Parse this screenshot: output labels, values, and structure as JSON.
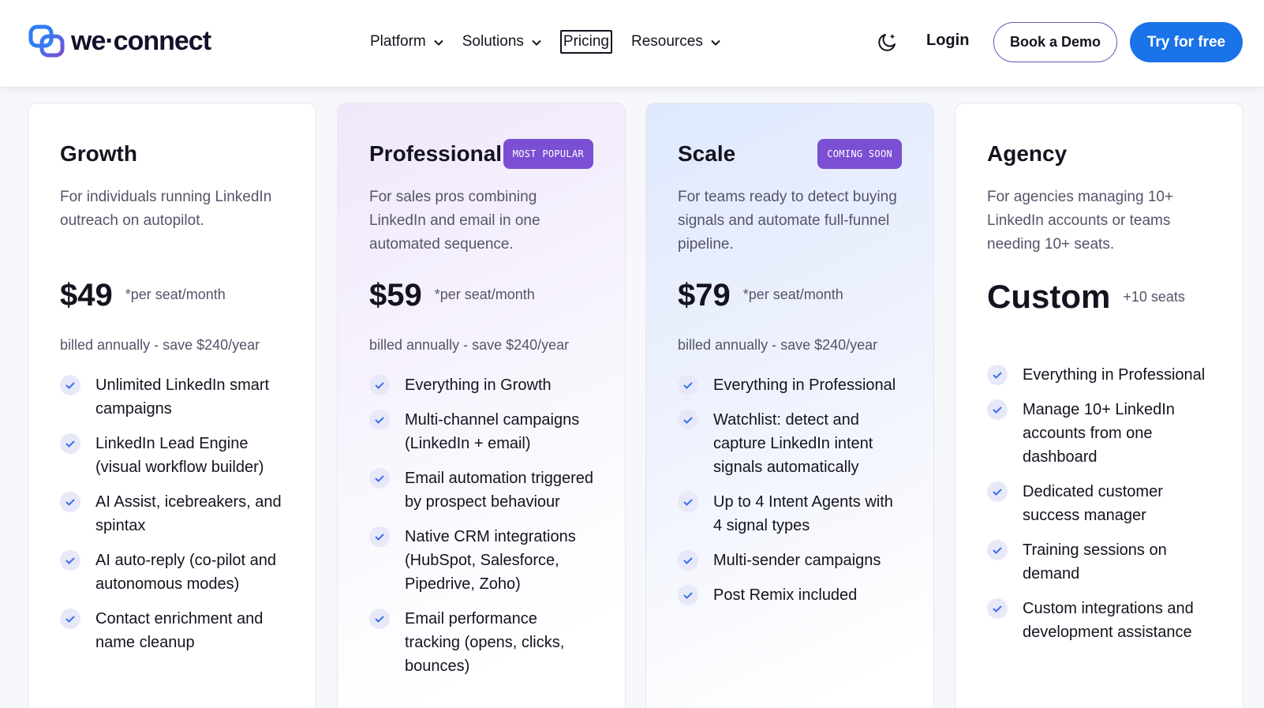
{
  "brand": {
    "name": "we·connect",
    "accent": "#1a73e8",
    "purple": "#7a4fd3"
  },
  "nav": {
    "items": [
      {
        "label": "Platform",
        "has_dropdown": true
      },
      {
        "label": "Solutions",
        "has_dropdown": true
      },
      {
        "label": "Pricing",
        "has_dropdown": false,
        "active": true
      },
      {
        "label": "Resources",
        "has_dropdown": true
      }
    ],
    "theme_toggle_icon": "moon-icon",
    "login_label": "Login",
    "demo_label": "Book a Demo",
    "try_label": "Try for free"
  },
  "plans": [
    {
      "title": "Growth",
      "badge": "",
      "description": "For individuals running LinkedIn outreach on autopilot.",
      "price": "$49",
      "price_note": "*per seat/month",
      "billing": "billed annually - save $240/year",
      "features": [
        "Unlimited LinkedIn smart campaigns",
        "LinkedIn Lead Engine (visual workflow builder)",
        "AI Assist, icebreakers, and spintax",
        "AI auto-reply (co-pilot and autonomous modes)",
        "Contact enrichment and name cleanup"
      ]
    },
    {
      "title": "Professional",
      "badge": "MOST POPULAR",
      "description": "For sales pros combining LinkedIn and email in one automated sequence.",
      "price": "$59",
      "price_note": "*per seat/month",
      "billing": "billed annually - save $240/year",
      "features": [
        "Everything in Growth",
        "Multi-channel campaigns (LinkedIn + email)",
        "Email automation triggered by prospect behaviour",
        "Native CRM integrations (HubSpot, Salesforce, Pipedrive, Zoho)",
        "Email performance tracking (opens, clicks, bounces)"
      ]
    },
    {
      "title": "Scale",
      "badge": "COMING SOON",
      "description": "For teams ready to detect buying signals and automate full-funnel pipeline.",
      "price": "$79",
      "price_note": "*per seat/month",
      "billing": "billed annually - save $240/year",
      "features": [
        "Everything in Professional",
        "Watchlist: detect and capture LinkedIn intent signals automatically",
        "Up to 4 Intent Agents with 4 signal types",
        "Multi-sender campaigns",
        "Post Remix included"
      ]
    },
    {
      "title": "Agency",
      "badge": "",
      "description": "For agencies managing 10+ LinkedIn accounts or teams needing 10+ seats.",
      "price": "Custom",
      "price_note": "+10 seats",
      "billing": "",
      "features": [
        "Everything in Professional",
        "Manage 10+ LinkedIn accounts from one dashboard",
        "Dedicated customer success manager",
        "Training sessions on demand",
        "Custom integrations and development assistance"
      ]
    }
  ]
}
